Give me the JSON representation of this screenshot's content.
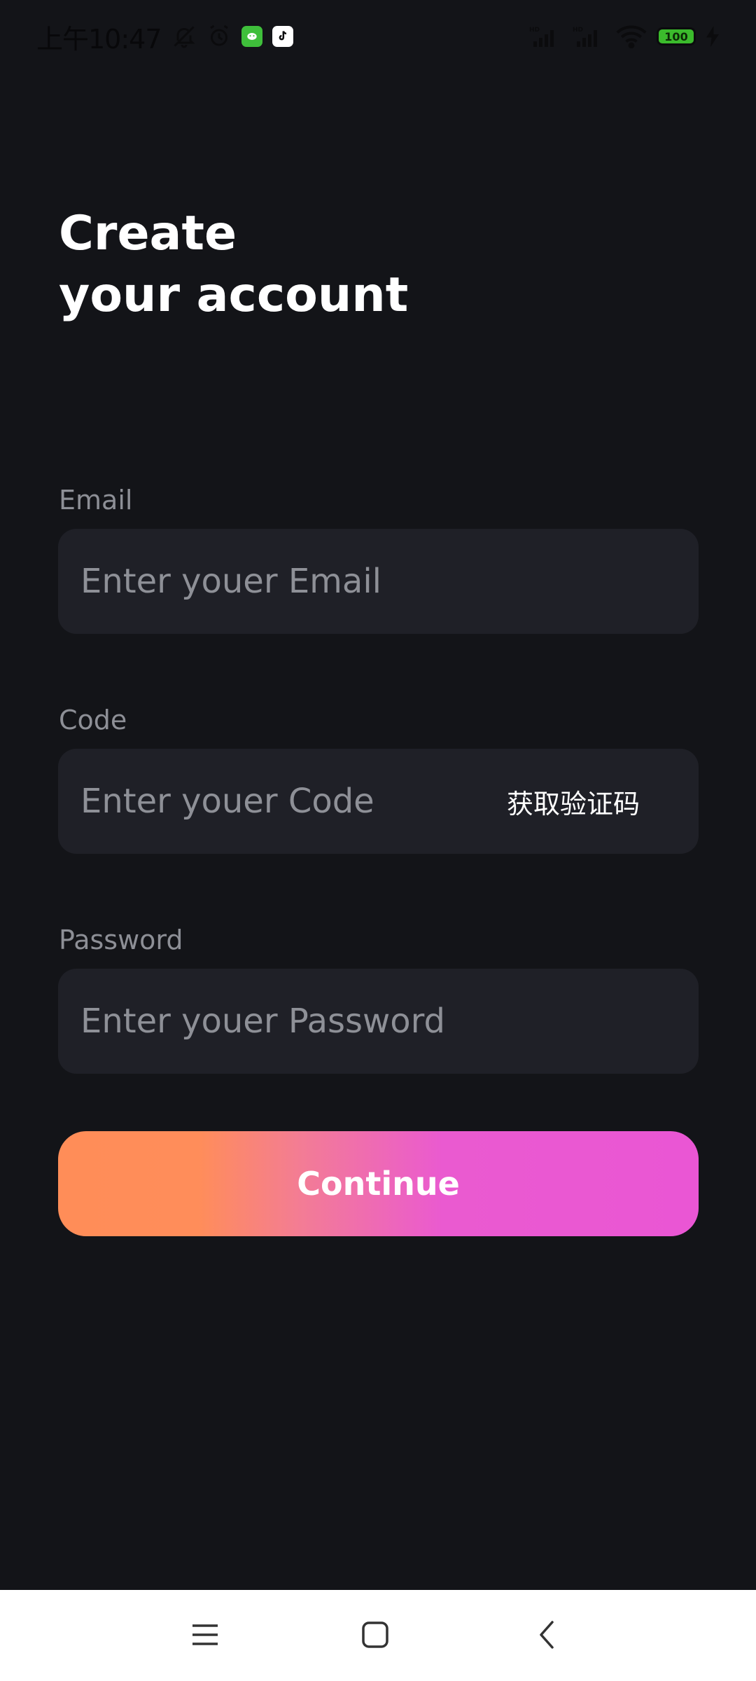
{
  "status_bar": {
    "time": "上午10:47",
    "battery_level": "100",
    "icons": [
      "bell-off-icon",
      "alarm-icon",
      "wechat-app-icon",
      "tiktok-app-icon",
      "signal-hd-icon",
      "signal-hd-icon",
      "wifi-icon",
      "battery-icon",
      "charging-icon"
    ],
    "battery_color": "#3bbb2c"
  },
  "header": {
    "title_line1": "Create",
    "title_line2": "your account"
  },
  "form": {
    "email": {
      "label": "Email",
      "value": "",
      "placeholder": "Enter youer Email"
    },
    "code": {
      "label": "Code",
      "value": "",
      "placeholder": "Enter youer Code",
      "get_code_label": "获取验证码"
    },
    "password": {
      "label": "Password",
      "value": "",
      "placeholder": "Enter youer Password"
    },
    "continue_label": "Continue"
  },
  "theme": {
    "background": "#131418",
    "field_background": "#1f2027",
    "button_gradient_start": "#ff8d58",
    "button_gradient_end": "#ea56d4"
  },
  "nav_bar": {
    "icons": [
      "menu-icon",
      "home-square-icon",
      "back-chevron-icon"
    ]
  }
}
